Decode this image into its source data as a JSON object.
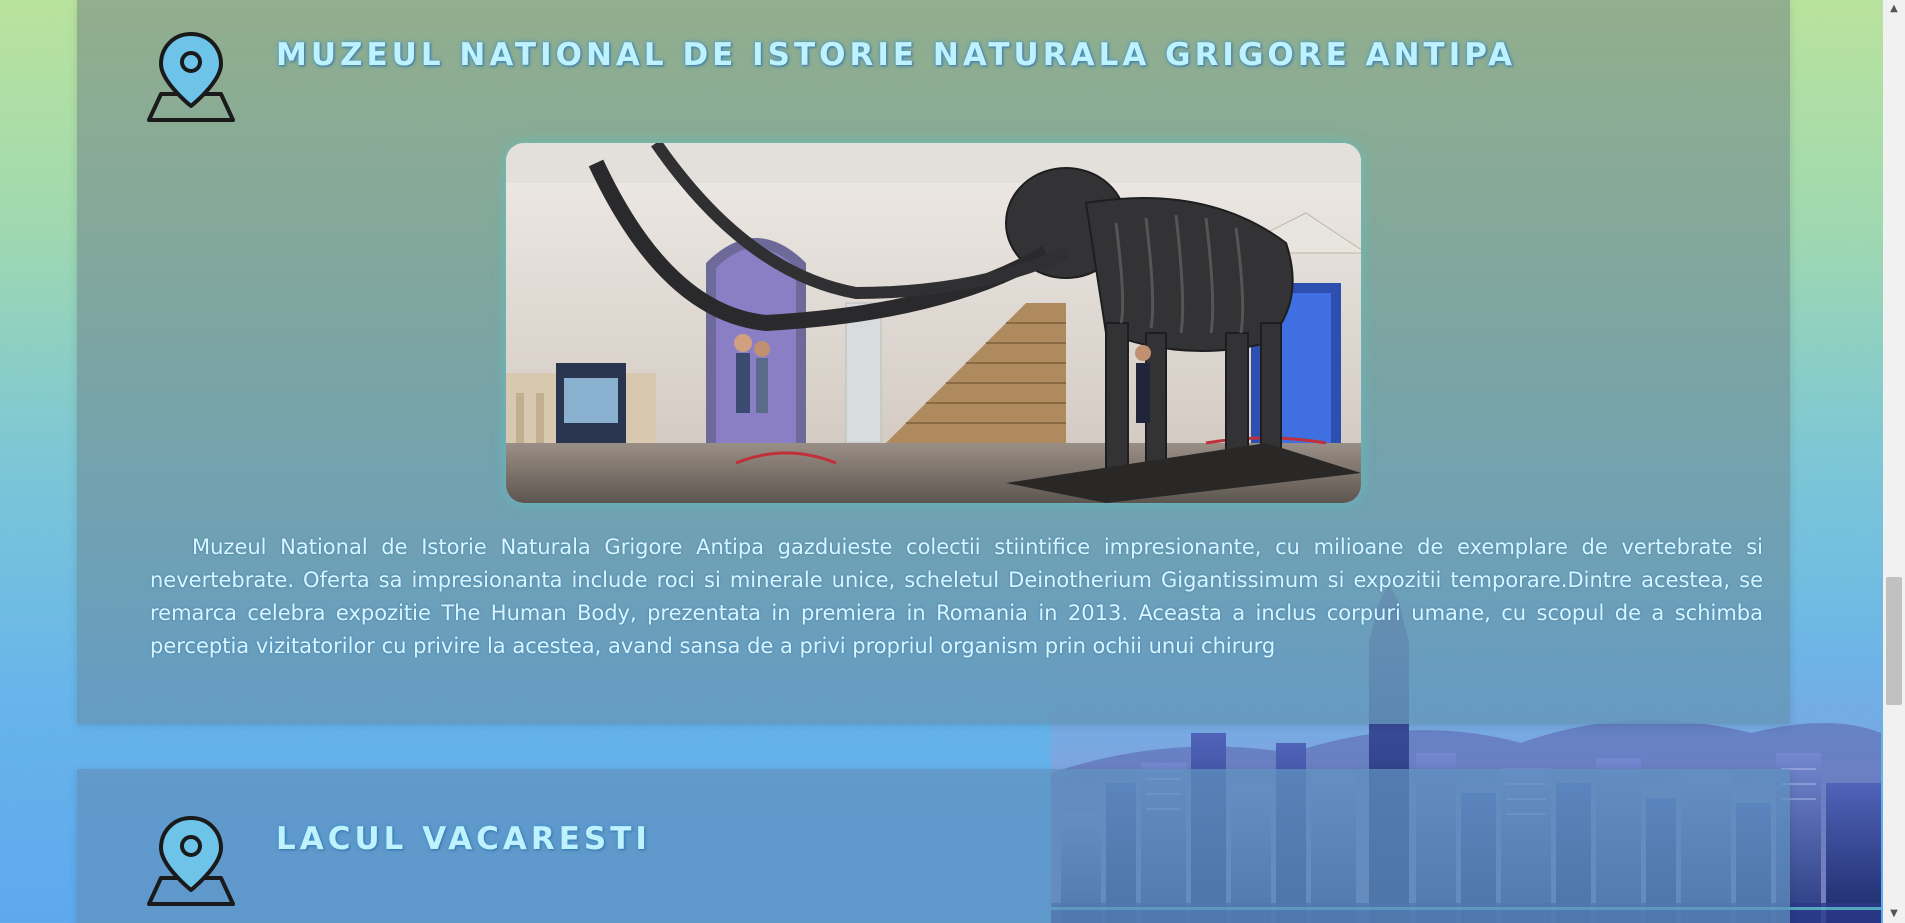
{
  "sections": [
    {
      "title": "MUZEUL NATIONAL DE ISTORIE NATURALA GRIGORE ANTIPA",
      "icon": "map-pin-icon",
      "image_icon": "museum-photo",
      "description": "Muzeul National de Istorie Naturala Grigore Antipa gazduieste colectii stiintifice impresionante, cu milioane de exemplare de vertebrate si nevertebrate. Oferta sa impresionanta include roci si minerale unice, scheletul Deinotherium Gigantissimum si expozitii temporare.Dintre acestea, se remarca celebra expozitie The Human Body, prezentata in premiera in Romania in 2013. Aceasta a inclus corpuri umane, cu scopul de a schimba perceptia vizitatorilor cu privire la acestea, avand sansa de a privi propriul organism prin ochii unui chirurg"
    },
    {
      "title": "LACUL VACARESTI",
      "icon": "map-pin-icon"
    }
  ],
  "colors": {
    "title": "#bff2ff",
    "text": "#d7f6ff",
    "pin_fill": "#6ec3e8",
    "pin_outline": "#1a1a1a"
  },
  "scrollbar": {
    "up_arrow": "▲",
    "down_arrow": "▼"
  }
}
